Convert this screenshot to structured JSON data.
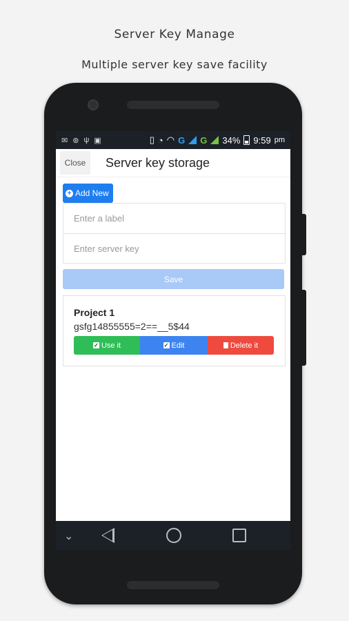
{
  "captions": {
    "title": "Server Key Manage",
    "subtitle": "Multiple server key save facility"
  },
  "status_bar": {
    "net1": "G",
    "net2": "G",
    "battery": "34%",
    "time": "9:59",
    "ampm": "pm"
  },
  "header": {
    "close_label": "Close",
    "title": "Server key storage"
  },
  "form": {
    "add_new_label": "Add New",
    "label_placeholder": "Enter a label",
    "key_placeholder": "Enter server key",
    "save_label": "Save"
  },
  "entries": [
    {
      "label": "Project 1",
      "key": "gsfg14855555=2==__5$44",
      "use_label": "Use it",
      "edit_label": "Edit",
      "delete_label": "Delete it"
    }
  ],
  "colors": {
    "add_new": "#1e7ef0",
    "save": "#a9c9f7",
    "use": "#2fbd57",
    "edit": "#3d84f0",
    "delete": "#ef4a3e"
  }
}
